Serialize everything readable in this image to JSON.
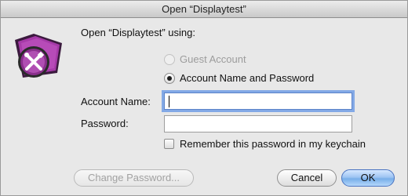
{
  "window": {
    "title": "Open “Displaytest”"
  },
  "app_icon": {
    "name": "filemaker-app-icon"
  },
  "prompt": "Open “Displaytest” using:",
  "auth_options": {
    "guest": {
      "label": "Guest Account",
      "selected": false,
      "enabled": false
    },
    "account": {
      "label": "Account Name and Password",
      "selected": true,
      "enabled": true
    }
  },
  "fields": {
    "account_name": {
      "label": "Account Name:",
      "value": "",
      "focused": true
    },
    "password": {
      "label": "Password:",
      "value": ""
    }
  },
  "remember": {
    "label": "Remember this password in my keychain",
    "checked": false
  },
  "buttons": {
    "change_password": "Change Password...",
    "cancel": "Cancel",
    "ok": "OK"
  },
  "colors": {
    "focus_ring": "#83a9e6",
    "default_button": "#78aee9",
    "icon_purple": "#8a2f8c"
  }
}
